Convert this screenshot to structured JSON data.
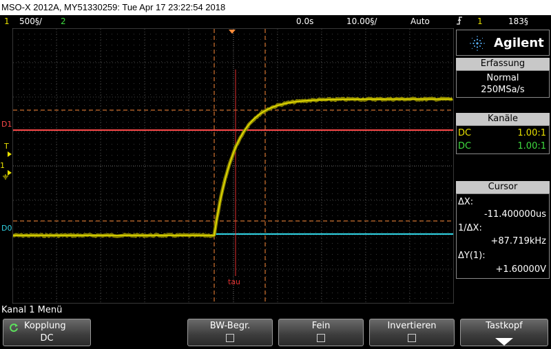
{
  "title": "MSO-X 2012A, MY51330259: Tue Apr 17 23:22:54 2018",
  "status": {
    "ch1_num": "1",
    "ch1_scale": "500§/",
    "ch2_num": "2",
    "time_offset": "0.0s",
    "time_scale": "10.00§/",
    "trigger_mode": "Auto",
    "trigger_icon": "rising-edge-icon",
    "trigger_ch": "1",
    "trigger_level": "183§"
  },
  "colors": {
    "ch1": "#e8e000",
    "ch2": "#3fdc3f",
    "d1": "#ff4a4a",
    "d0": "#31d5e6",
    "cursor_x": "#ff8c3a",
    "tau": "#e23030"
  },
  "brand": "Agilent",
  "acquisition": {
    "title": "Erfassung",
    "mode": "Normal",
    "rate": "250MSa/s"
  },
  "channels": {
    "title": "Kanäle",
    "rows": [
      {
        "coupling": "DC",
        "ratio": "1.00:1"
      },
      {
        "coupling": "DC",
        "ratio": "1.00:1"
      }
    ]
  },
  "cursor": {
    "title": "Cursor",
    "dx_label": "ΔX:",
    "dx_value": "-11.400000us",
    "inv_dx_label": "1/ΔX:",
    "inv_dx_value": "+87.719kHz",
    "dy_label": "ΔY(1):",
    "dy_value": "+1.60000V"
  },
  "markers": {
    "d1": "D1",
    "d0": "D0",
    "t": "T",
    "ch1": "1",
    "tau": "tau"
  },
  "menu": {
    "label": "Kanal 1 Menü",
    "softkeys": [
      {
        "label": "Kopplung",
        "value": "DC"
      },
      {
        "label": "BW-Begr."
      },
      {
        "label": "Fein"
      },
      {
        "label": "Invertieren"
      },
      {
        "label": "Tastkopf"
      }
    ]
  }
}
